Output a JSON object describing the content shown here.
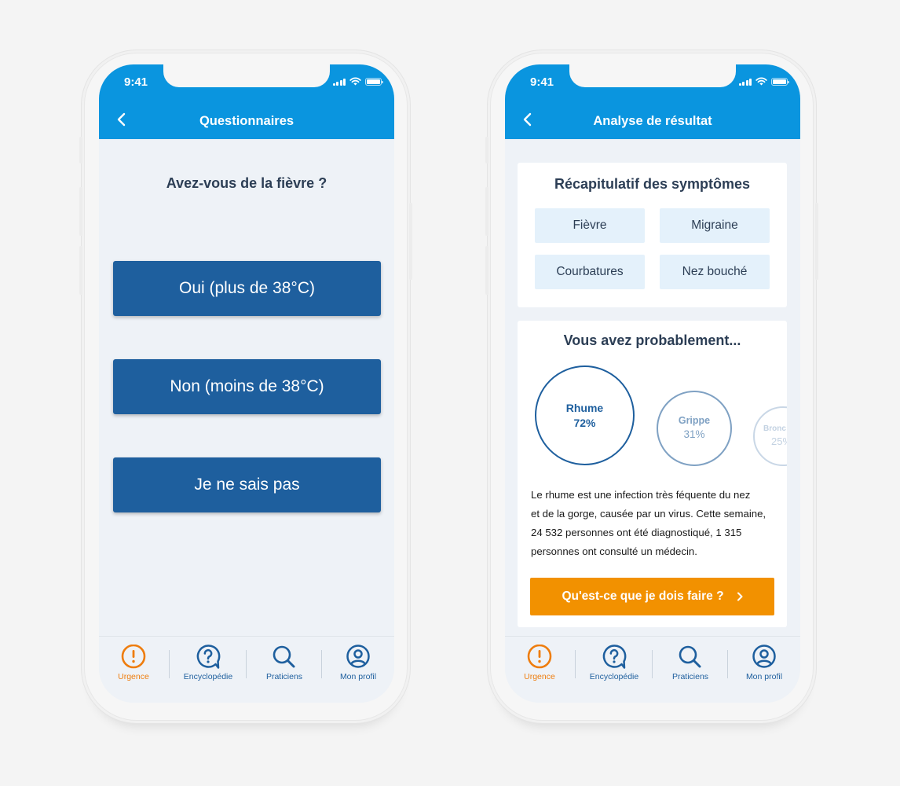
{
  "status_bar": {
    "time": "9:41"
  },
  "screen_questionnaire": {
    "title": "Questionnaires",
    "question": "Avez-vous de la fièvre ?",
    "answers": [
      "Oui (plus de 38°C)",
      "Non (moins de 38°C)",
      "Je ne sais pas"
    ]
  },
  "screen_result": {
    "title": "Analyse de résultat",
    "summary_title": "Récapitulatif des symptômes",
    "symptoms": [
      "Fièvre",
      "Migraine",
      "Courbatures",
      "Nez bouché"
    ],
    "probable_title": "Vous avez probablement...",
    "diagnoses": [
      {
        "name": "Rhume",
        "percent": "72%"
      },
      {
        "name": "Grippe",
        "percent": "31%"
      },
      {
        "name": "Bronc",
        "percent": "25%"
      }
    ],
    "description_lines": [
      "Le rhume est une infection très féquente du nez",
      "et de la gorge, causée par un virus. Cette semaine,",
      "24 532 personnes ont été diagnostiqué, 1 315",
      "personnes ont consulté un médecin."
    ],
    "cta_label": "Qu'est-ce que je dois faire ?"
  },
  "tabbar": {
    "items": [
      {
        "label": "Urgence",
        "icon": "alert-circle-icon",
        "active": true
      },
      {
        "label": "Encyclopédie",
        "icon": "help-bubble-icon",
        "active": false
      },
      {
        "label": "Praticiens",
        "icon": "search-icon",
        "active": false
      },
      {
        "label": "Mon profil",
        "icon": "user-circle-icon",
        "active": false
      }
    ]
  },
  "colors": {
    "header": "#0a95df",
    "primary_button": "#1e5f9e",
    "accent_orange": "#f29100",
    "active_tab": "#ee7d0e",
    "chip_bg": "#e4f1fb",
    "screen_bg": "#eef2f7"
  }
}
